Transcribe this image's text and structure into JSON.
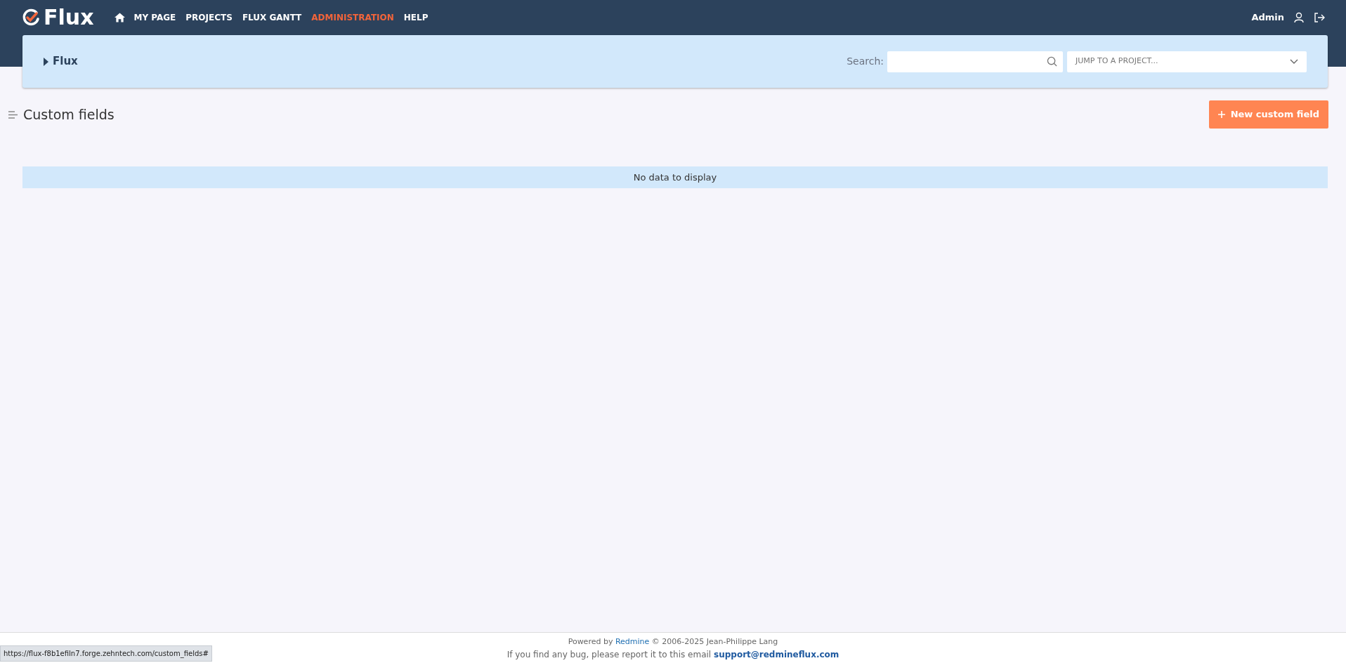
{
  "header": {
    "logo": "Flux",
    "nav": [
      {
        "label": "MY PAGE",
        "selected": false
      },
      {
        "label": "PROJECTS",
        "selected": false
      },
      {
        "label": "FLUX GANTT",
        "selected": false
      },
      {
        "label": "ADMINISTRATION",
        "selected": true
      },
      {
        "label": "HELP",
        "selected": false
      }
    ],
    "user": "Admin"
  },
  "project_bar": {
    "project": "Flux",
    "search_label": "Search:",
    "jump_placeholder": "JUMP TO A PROJECT..."
  },
  "page": {
    "title": "Custom fields",
    "new_button": "New custom field",
    "empty_message": "No data to display"
  },
  "footer": {
    "powered_prefix": "Powered by",
    "powered_link": "Redmine",
    "powered_suffix": "© 2006-2025 Jean-Philippe Lang",
    "bug_text": "If you find any bug, please report it to this email",
    "bug_email": "support@redmineflux.com"
  },
  "status_url": "https://flux-f8b1efiln7.forge.zehntech.com/custom_fields#"
}
